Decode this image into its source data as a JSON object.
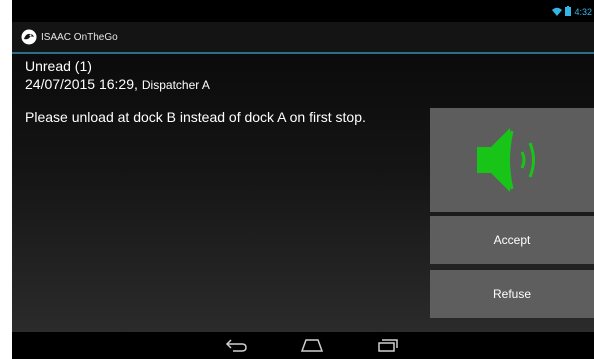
{
  "status": {
    "time": "4:32",
    "wifi_icon": "wifi-icon",
    "battery_icon": "battery-icon"
  },
  "app": {
    "title": "ISAAC OnTheGo",
    "logo_icon": "app-logo-icon",
    "accent": "#33b5e5"
  },
  "message": {
    "heading": "Unread (1)",
    "datetime": "24/07/2015 16:29,",
    "sender": "Dispatcher A",
    "body": "Please unload at dock B instead of dock A on first stop."
  },
  "actions": {
    "audio_icon": "speaker-icon",
    "audio_color": "#18c418",
    "accept_label": "Accept",
    "refuse_label": "Refuse"
  },
  "navbar": {
    "back_icon": "back-icon",
    "home_icon": "home-icon",
    "recents_icon": "recents-icon"
  }
}
